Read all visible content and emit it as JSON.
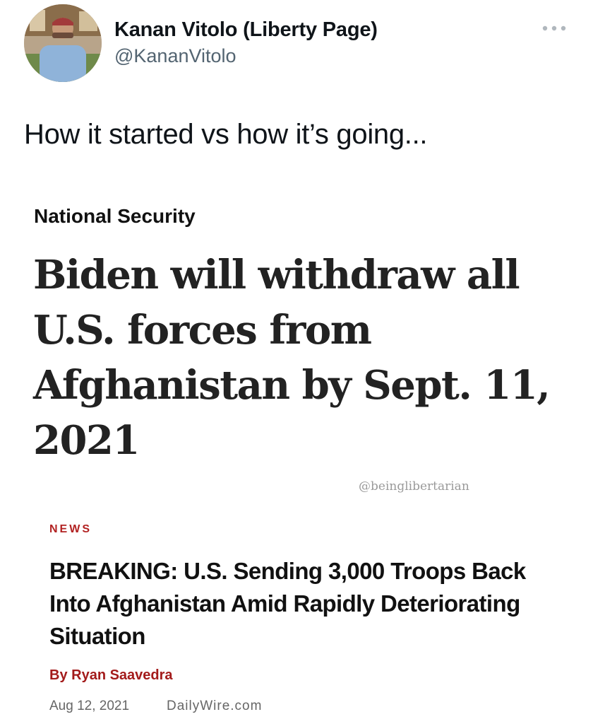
{
  "tweet": {
    "author_name": "Kanan Vitolo (Liberty Page)",
    "author_handle": "@KananVitolo",
    "text": "How it started vs how it’s going...",
    "more_icon": "more-horizontal-icon"
  },
  "article_1": {
    "section": "National Security",
    "headline": "Biden will withdraw all U.S. forces from Afghanistan by Sept. 11, 2021",
    "watermark": "@beinglibertarian"
  },
  "article_2": {
    "section": "NEWS",
    "headline": "BREAKING: U.S. Sending 3,000 Troops Back Into Afghanistan Amid Rapidly Deteriorating Situation",
    "byline": "By Ryan Saavedra",
    "date": "Aug 12, 2021",
    "site": "DailyWire.com"
  },
  "colors": {
    "handle_gray": "#536471",
    "news_red": "#b22222",
    "byline_red": "#a31b1b"
  }
}
